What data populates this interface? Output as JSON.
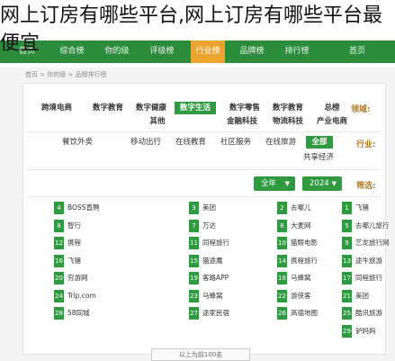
{
  "page_title": "网上订房有哪些平台,网上订房有哪些平台最便宜",
  "nav": {
    "items": [
      "首页",
      "",
      "",
      "",
      "",
      "",
      "",
      "",
      "",
      "",
      ""
    ],
    "visible": [
      "首页",
      "行业",
      "评级",
      "",
      "排行榜",
      "",
      "品牌",
      "",
      "",
      "首页"
    ]
  },
  "navbar": {
    "labels": [
      "首页",
      "综合榜",
      "你的级",
      "评级榜",
      "行业榜",
      "品牌榜",
      "排行榜",
      "首页"
    ]
  },
  "breadcrumb": "首页 > 你的级 > 品牌排行榜",
  "filters": {
    "domain_label": "领域:",
    "domain_row1": [
      "总榜",
      "数字教育",
      "数字健康",
      "数字生活",
      "数字零售",
      "数字教育",
      "跨境电商"
    ],
    "domain_row2": [
      "产业电商",
      "",
      "其他",
      "金融科技",
      "物流科技"
    ],
    "industry_label": "行业:",
    "industry_row1": [
      "全部",
      "在线旅游",
      "社区服务",
      "在线教育",
      "移动出行",
      "餐饮外卖"
    ],
    "industry_row2": [
      "共享经济"
    ],
    "select_label": "筛选:",
    "year": "2024",
    "season": "全年"
  },
  "ranking": {
    "col1": [
      {
        "n": "1",
        "name": "飞猪"
      },
      {
        "n": "5",
        "name": "去哪儿旅行"
      },
      {
        "n": "9",
        "name": "艺龙旅行网"
      },
      {
        "n": "13",
        "name": "途牛旅游"
      },
      {
        "n": "17",
        "name": "同程旅行"
      },
      {
        "n": "21",
        "name": "美团"
      },
      {
        "n": "25",
        "name": "酷讯旅游"
      },
      {
        "n": "29",
        "name": "驴妈妈"
      }
    ],
    "col2": [
      {
        "n": "2",
        "name": "去哪儿"
      },
      {
        "n": "6",
        "name": "大麦网"
      },
      {
        "n": "10",
        "name": "猫眼电影"
      },
      {
        "n": "14",
        "name": "携程旅行"
      },
      {
        "n": "18",
        "name": "马蜂窝"
      },
      {
        "n": "22",
        "name": "游侠客"
      },
      {
        "n": "26",
        "name": "高德地图"
      }
    ],
    "col3": [
      {
        "n": "3",
        "name": "美团"
      },
      {
        "n": "7",
        "name": "万达"
      },
      {
        "n": "11",
        "name": "同程旅行"
      },
      {
        "n": "15",
        "name": "猫途鹰"
      },
      {
        "n": "19",
        "name": "客路APP"
      },
      {
        "n": "23",
        "name": "马蜂窝"
      },
      {
        "n": "27",
        "name": "途家民宿"
      }
    ],
    "col4": [
      {
        "n": "4",
        "name": "BOSS直聘"
      },
      {
        "n": "8",
        "name": "智行"
      },
      {
        "n": "12",
        "name": "携程"
      },
      {
        "n": "16",
        "name": "飞猪"
      },
      {
        "n": "20",
        "name": "穷游网"
      },
      {
        "n": "24",
        "name": "Trip.com"
      },
      {
        "n": "28",
        "name": "58同城"
      }
    ]
  },
  "footer_button": "以上为前100名"
}
